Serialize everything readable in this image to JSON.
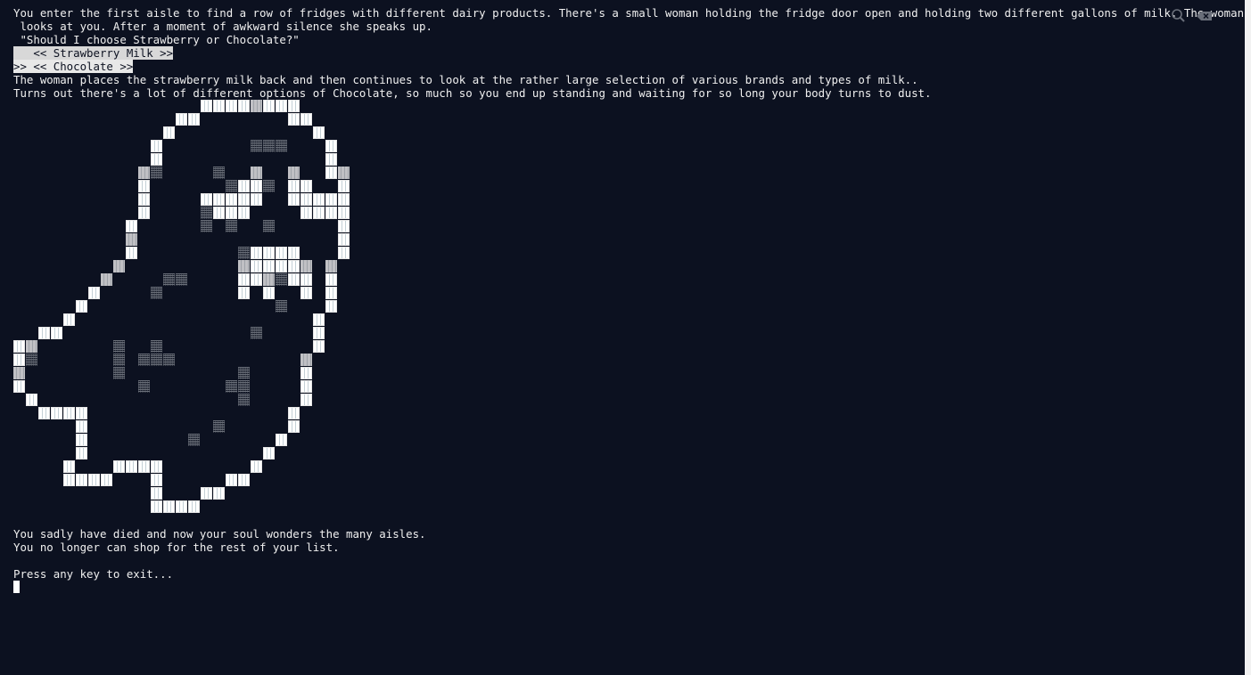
{
  "terminal": {
    "lines": [
      "You enter the first aisle to find a row of fridges with different dairy products. There's a small woman holding the fridge door open and holding two different gallons of milk. The woman turns and",
      " looks at you. After a moment of awkward silence she speaks up.",
      " \"Should I choose Strawberry or Chocolate?\"",
      "   << Strawberry Milk >>",
      ">> << Chocolate >>",
      "The woman places the strawberry milk back and then continues to look at the rather large selection of various brands and types of milk..",
      "Turns out there's a lot of different options of Chocolate, so much so you end up standing and waiting for so long your body turns to dust.",
      "You sadly have died and now your soul wonders the many aisles.",
      "You no longer can shop for the rest of your list.",
      "",
      "Press any key to exit..."
    ],
    "menu": {
      "options": [
        "   << Strawberry Milk >>",
        ">> << Chocolate >>"
      ],
      "selected_index": 1
    }
  },
  "icons": {
    "search": "search-icon",
    "close": "close-icon",
    "cursor": "terminal-cursor-icon"
  },
  "colors": {
    "background": "#0c1120",
    "text": "#f0f0f0",
    "highlight": "#e8e8e8",
    "scrollbar": "#f2f2f2"
  }
}
